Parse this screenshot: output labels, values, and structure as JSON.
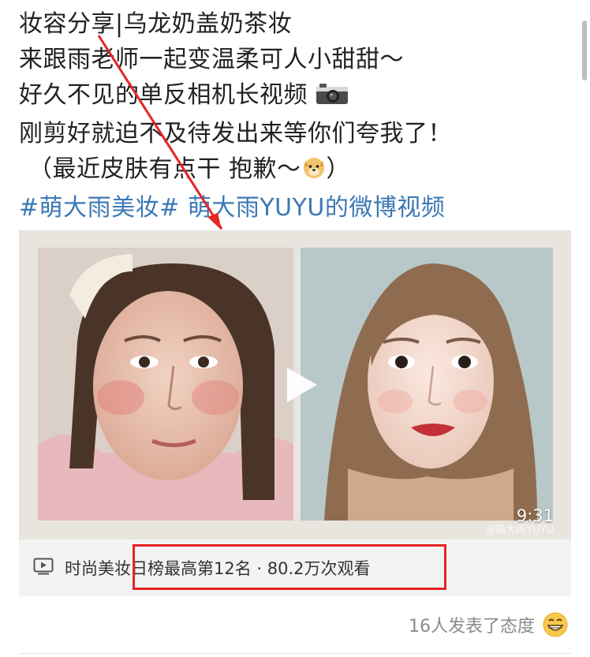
{
  "post": {
    "line1": "妆容分享|乌龙奶盖奶茶妆",
    "line2": "来跟雨老师一起变温柔可人小甜甜～",
    "line3": "好久不见的单反相机长视频",
    "line4": "刚剪好就迫不及待发出来等你们夸我了！",
    "line5_prefix": "（最近皮肤有点干 抱歉～",
    "line5_suffix": "）",
    "hashtag": "#萌大雨美妆#",
    "video_link": " 萌大雨YUYU的微博视频"
  },
  "video": {
    "duration": "9:31",
    "watermark": "@萌大雨YUYU"
  },
  "stats": {
    "text": "时尚美妆日榜最高第12名 · 80.2万次观看"
  },
  "reactions": {
    "text": "16人发表了态度"
  },
  "colors": {
    "hashtag": "#3b78b5",
    "annotation": "#e52424"
  }
}
